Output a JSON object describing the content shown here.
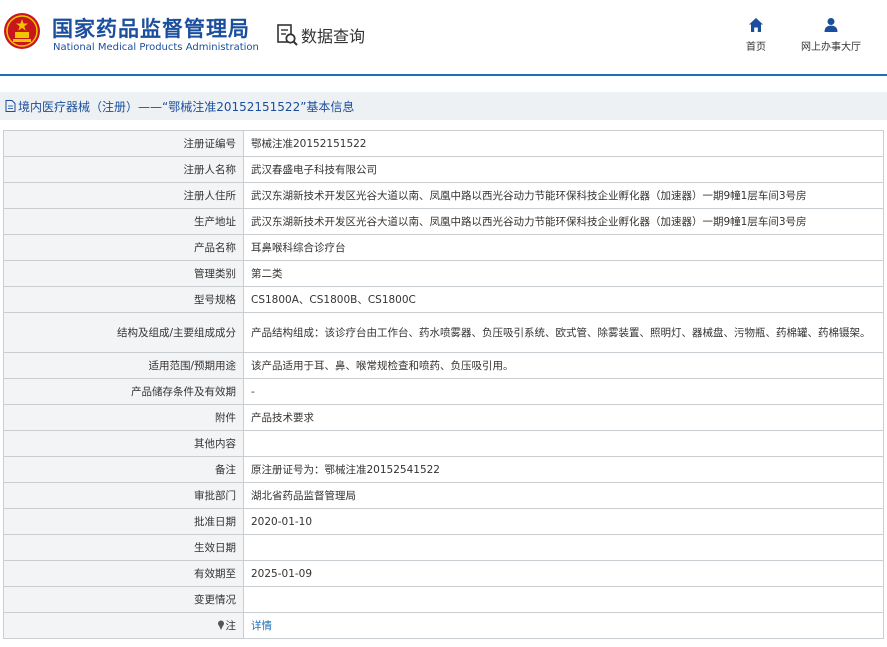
{
  "header": {
    "brand_cn": "国家药品监督管理局",
    "brand_en": "National Medical Products Administration",
    "query_label": "数据查询",
    "nav": [
      {
        "label": "首页",
        "icon": "home-icon"
      },
      {
        "label": "网上办事大厅",
        "icon": "user-icon"
      }
    ]
  },
  "breadcrumb": {
    "icon": "document-icon",
    "text": "境内医疗器械（注册）——“鄂械注准20152151522”基本信息"
  },
  "rows": [
    {
      "label": "注册证编号",
      "value": "鄂械注准20152151522"
    },
    {
      "label": "注册人名称",
      "value": "武汉春盛电子科技有限公司"
    },
    {
      "label": "注册人住所",
      "value": "武汉东湖新技术开发区光谷大道以南、凤凰中路以西光谷动力节能环保科技企业孵化器（加速器）一期9幢1层车间3号房"
    },
    {
      "label": "生产地址",
      "value": "武汉东湖新技术开发区光谷大道以南、凤凰中路以西光谷动力节能环保科技企业孵化器（加速器）一期9幢1层车间3号房"
    },
    {
      "label": "产品名称",
      "value": "耳鼻喉科综合诊疗台"
    },
    {
      "label": "管理类别",
      "value": "第二类"
    },
    {
      "label": "型号规格",
      "value": "CS1800A、CS1800B、CS1800C"
    },
    {
      "label": "结构及组成/主要组成成分",
      "value": "产品结构组成：该诊疗台由工作台、药水喷雾器、负压吸引系统、欧式管、除雾装置、照明灯、器械盘、污物瓶、药棉罐、药棉镊架。"
    },
    {
      "label": "适用范围/预期用途",
      "value": "该产品适用于耳、鼻、喉常规检查和喷药、负压吸引用。"
    },
    {
      "label": "产品储存条件及有效期",
      "value": "-"
    },
    {
      "label": "附件",
      "value": "产品技术要求"
    },
    {
      "label": "其他内容",
      "value": ""
    },
    {
      "label": "备注",
      "value": "原注册证号为：鄂械注准20152541522"
    },
    {
      "label": "审批部门",
      "value": "湖北省药品监督管理局"
    },
    {
      "label": "批准日期",
      "value": "2020-01-10"
    },
    {
      "label": "生效日期",
      "value": ""
    },
    {
      "label": "有效期至",
      "value": "2025-01-09"
    },
    {
      "label": "变更情况",
      "value": ""
    }
  ],
  "note_row": {
    "label": "注",
    "icon": "pin-icon",
    "link": "详情"
  },
  "colors": {
    "brand_blue": "#1b4e9c",
    "link_blue": "#1f6fb5",
    "label_bg": "#f3f4f6",
    "breadcrumb_bg": "#eef1f4",
    "border": "#c9ced3"
  }
}
